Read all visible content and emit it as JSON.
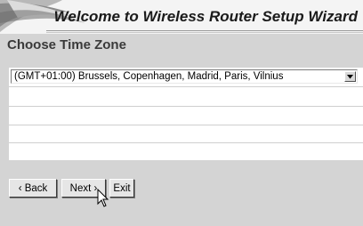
{
  "header": {
    "title": "Welcome to Wireless Router Setup Wizard"
  },
  "section": {
    "title": "Choose Time Zone"
  },
  "timezone_select": {
    "selected": "(GMT+01:00) Brussels, Copenhagen, Madrid, Paris, Vilnius"
  },
  "buttons": {
    "back_label": "‹ Back",
    "next_label": "Next ›",
    "exit_label": "Exit"
  },
  "icons": {
    "header_decoration": "wave-swoosh-icon",
    "dropdown": "chevron-down-icon",
    "cursor": "mouse-pointer-icon"
  },
  "colors": {
    "panel_background": "#d4d4d4",
    "header_background": "#f4f4f4",
    "button_face": "#e6e6e6"
  }
}
